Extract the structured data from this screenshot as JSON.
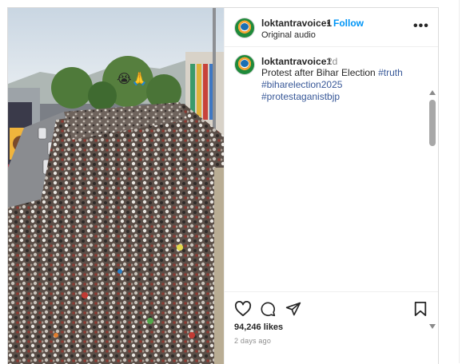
{
  "post": {
    "username": "loktantravoice1",
    "follow_label": "Follow",
    "separator": "•",
    "audio_label": "Original audio",
    "more_label": "•••",
    "media_emoji": "😭🙏"
  },
  "comment": {
    "username": "loktantravoice1",
    "age": "2d",
    "text_plain": "Protest after Bihar Election ",
    "tags": [
      "#truth",
      "#biharelection2025",
      "#protestaganistbjp"
    ]
  },
  "actions": {
    "likes": "94,246 likes",
    "time_ago": "2 days ago"
  },
  "colors": {
    "link_blue": "#0095f6",
    "hashtag": "#385898",
    "muted": "#8e8e8e",
    "text": "#262626"
  },
  "icons": [
    "heart-icon",
    "comment-icon",
    "share-icon",
    "bookmark-icon",
    "more-options-icon"
  ]
}
